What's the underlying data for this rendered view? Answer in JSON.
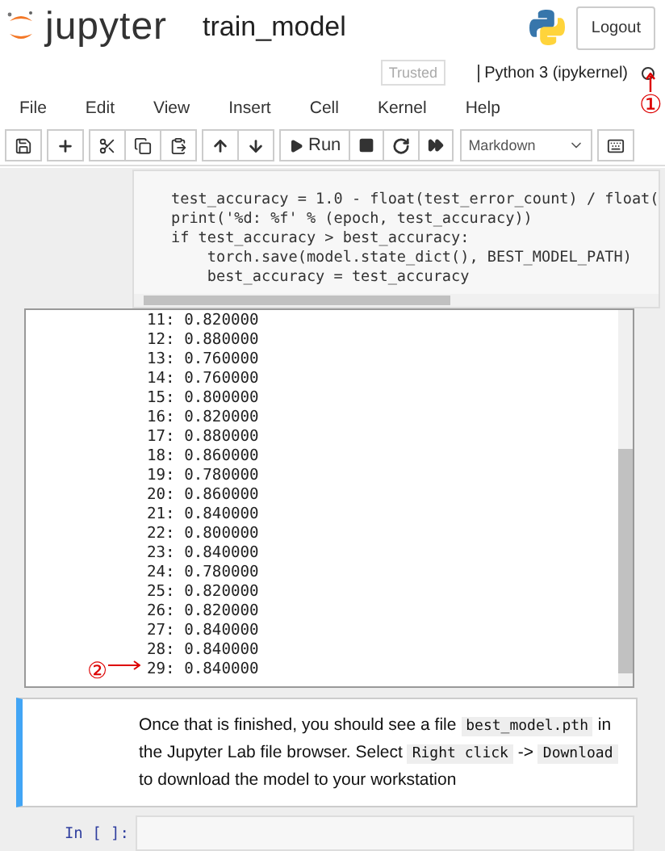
{
  "header": {
    "logo_text": "jupyter",
    "notebook_name": "train_model",
    "logout": "Logout"
  },
  "status": {
    "trusted": "Trusted",
    "kernel": "Python 3 (ipykernel)",
    "annotation": "①"
  },
  "menu": [
    "File",
    "Edit",
    "View",
    "Insert",
    "Cell",
    "Kernel",
    "Help"
  ],
  "toolbar": {
    "run": "Run",
    "cell_type": "Markdown"
  },
  "code_cell": {
    "lines": [
      "test_accuracy = 1.0 - float(test_error_count) / float(",
      "print('%d: %f' % (epoch, test_accuracy))",
      "if test_accuracy > best_accuracy:",
      "    torch.save(model.state_dict(), BEST_MODEL_PATH)",
      "    best_accuracy = test_accuracy"
    ]
  },
  "output": {
    "lines": [
      "11: 0.820000",
      "12: 0.880000",
      "13: 0.760000",
      "14: 0.760000",
      "15: 0.800000",
      "16: 0.820000",
      "17: 0.880000",
      "18: 0.860000",
      "19: 0.780000",
      "20: 0.860000",
      "21: 0.840000",
      "22: 0.800000",
      "23: 0.840000",
      "24: 0.780000",
      "25: 0.820000",
      "26: 0.820000",
      "27: 0.840000",
      "28: 0.840000",
      "29: 0.840000"
    ],
    "annotation": "②"
  },
  "markdown_cell": {
    "segments": [
      {
        "kind": "text",
        "text": "Once that is finished, you should see a file "
      },
      {
        "kind": "code",
        "text": "best_model.pth"
      },
      {
        "kind": "text",
        "text": " in the Jupyter Lab file browser. Select "
      },
      {
        "kind": "code",
        "text": "Right click"
      },
      {
        "kind": "text",
        "text": " -> "
      },
      {
        "kind": "code",
        "text": "Download"
      },
      {
        "kind": "text",
        "text": " to download the model to your workstation"
      }
    ]
  },
  "input_cell": {
    "prompt": "In [ ]:"
  }
}
